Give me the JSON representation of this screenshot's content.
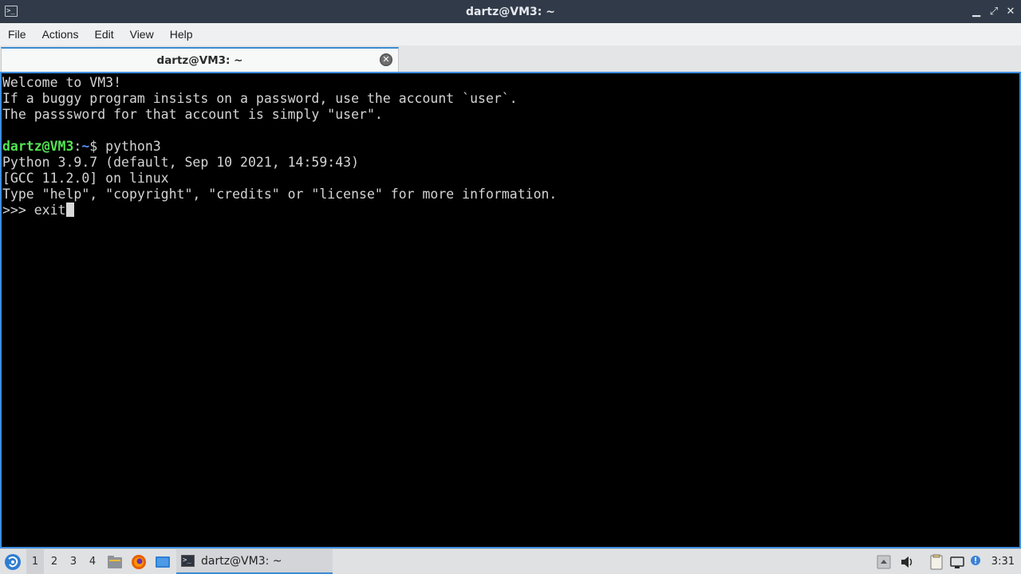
{
  "window": {
    "title": "dartz@VM3: ~",
    "icon_text": ">_",
    "minimize_glyph": "▁",
    "maximize_glyph": "⤢",
    "close_glyph": "✕"
  },
  "menu": [
    "File",
    "Actions",
    "Edit",
    "View",
    "Help"
  ],
  "tab": {
    "label": "dartz@VM3: ~",
    "close_glyph": "✕"
  },
  "terminal": {
    "welcome": [
      "Welcome to VM3!",
      "If a buggy program insists on a password, use the account `user`.",
      "The passsword for that account is simply \"user\"."
    ],
    "prompt_user": "dartz@VM3",
    "prompt_sep": ":",
    "prompt_path": "~",
    "prompt_symbol": "$ ",
    "command": "python3",
    "python_output": [
      "Python 3.9.7 (default, Sep 10 2021, 14:59:43)",
      "[GCC 11.2.0] on linux",
      "Type \"help\", \"copyright\", \"credits\" or \"license\" for more information."
    ],
    "repl_prompt": ">>> ",
    "repl_input": "exit"
  },
  "taskbar": {
    "workspaces": [
      "1",
      "2",
      "3",
      "4"
    ],
    "active_workspace": "1",
    "task_label": "dartz@VM3: ~",
    "task_icon_text": ">_",
    "clock": "3:31",
    "accent_color": "#3b8bd0"
  }
}
